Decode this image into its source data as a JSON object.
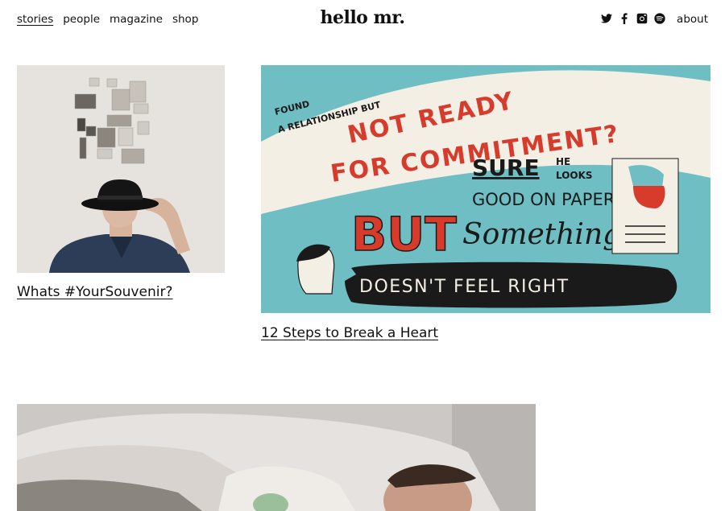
{
  "nav": {
    "items": [
      {
        "label": "stories",
        "active": true
      },
      {
        "label": "people",
        "active": false
      },
      {
        "label": "magazine",
        "active": false
      },
      {
        "label": "shop",
        "active": false
      }
    ],
    "about": "about"
  },
  "brand": {
    "logo": "hello mr."
  },
  "social": [
    "twitter-icon",
    "facebook-icon",
    "instagram-icon",
    "spotify-icon"
  ],
  "stories": [
    {
      "title": "Whats #YourSouvenir?"
    },
    {
      "title": "12 Steps to Break a Heart",
      "illustration": {
        "line1": "FOUND",
        "line2": "A RELATIONSHIP BUT",
        "line3": "NOT READY",
        "line4": "FOR COMMITMENT?",
        "line5a": "SURE",
        "line5b": "HE",
        "line5c": "LOOKS",
        "line6": "GOOD ON PAPER",
        "line7a": "BUT",
        "line7b": "Something",
        "line8": "DOESN'T FEEL RIGHT"
      }
    },
    {
      "title": ""
    }
  ],
  "colors": {
    "red": "#d63b2c",
    "teal": "#6ebec3",
    "cream": "#f4efe4",
    "ink": "#1a1a1a"
  }
}
